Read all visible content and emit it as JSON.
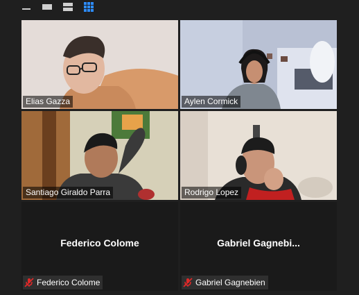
{
  "toolbar": {
    "buttons": [
      {
        "name": "minimize-icon"
      },
      {
        "name": "speaker-view-icon"
      },
      {
        "name": "two-row-view-icon"
      },
      {
        "name": "gallery-view-icon"
      }
    ],
    "accent": "#2d8cff"
  },
  "participants": [
    {
      "name": "Elias Gazza"
    },
    {
      "name": "Aylen Cormick"
    },
    {
      "name": "Santiago Giraldo Parra",
      "active": true
    },
    {
      "name": "Rodrigo Lopez"
    },
    {
      "name": "Federico Colome",
      "display": "Federico Colome",
      "muted": true
    },
    {
      "name": "Gabriel Gagnebien",
      "display": "Gabriel  Gagnebi...",
      "muted": true
    }
  ],
  "colors": {
    "active_border": "#e8e08a",
    "mute_red": "#e02828"
  }
}
